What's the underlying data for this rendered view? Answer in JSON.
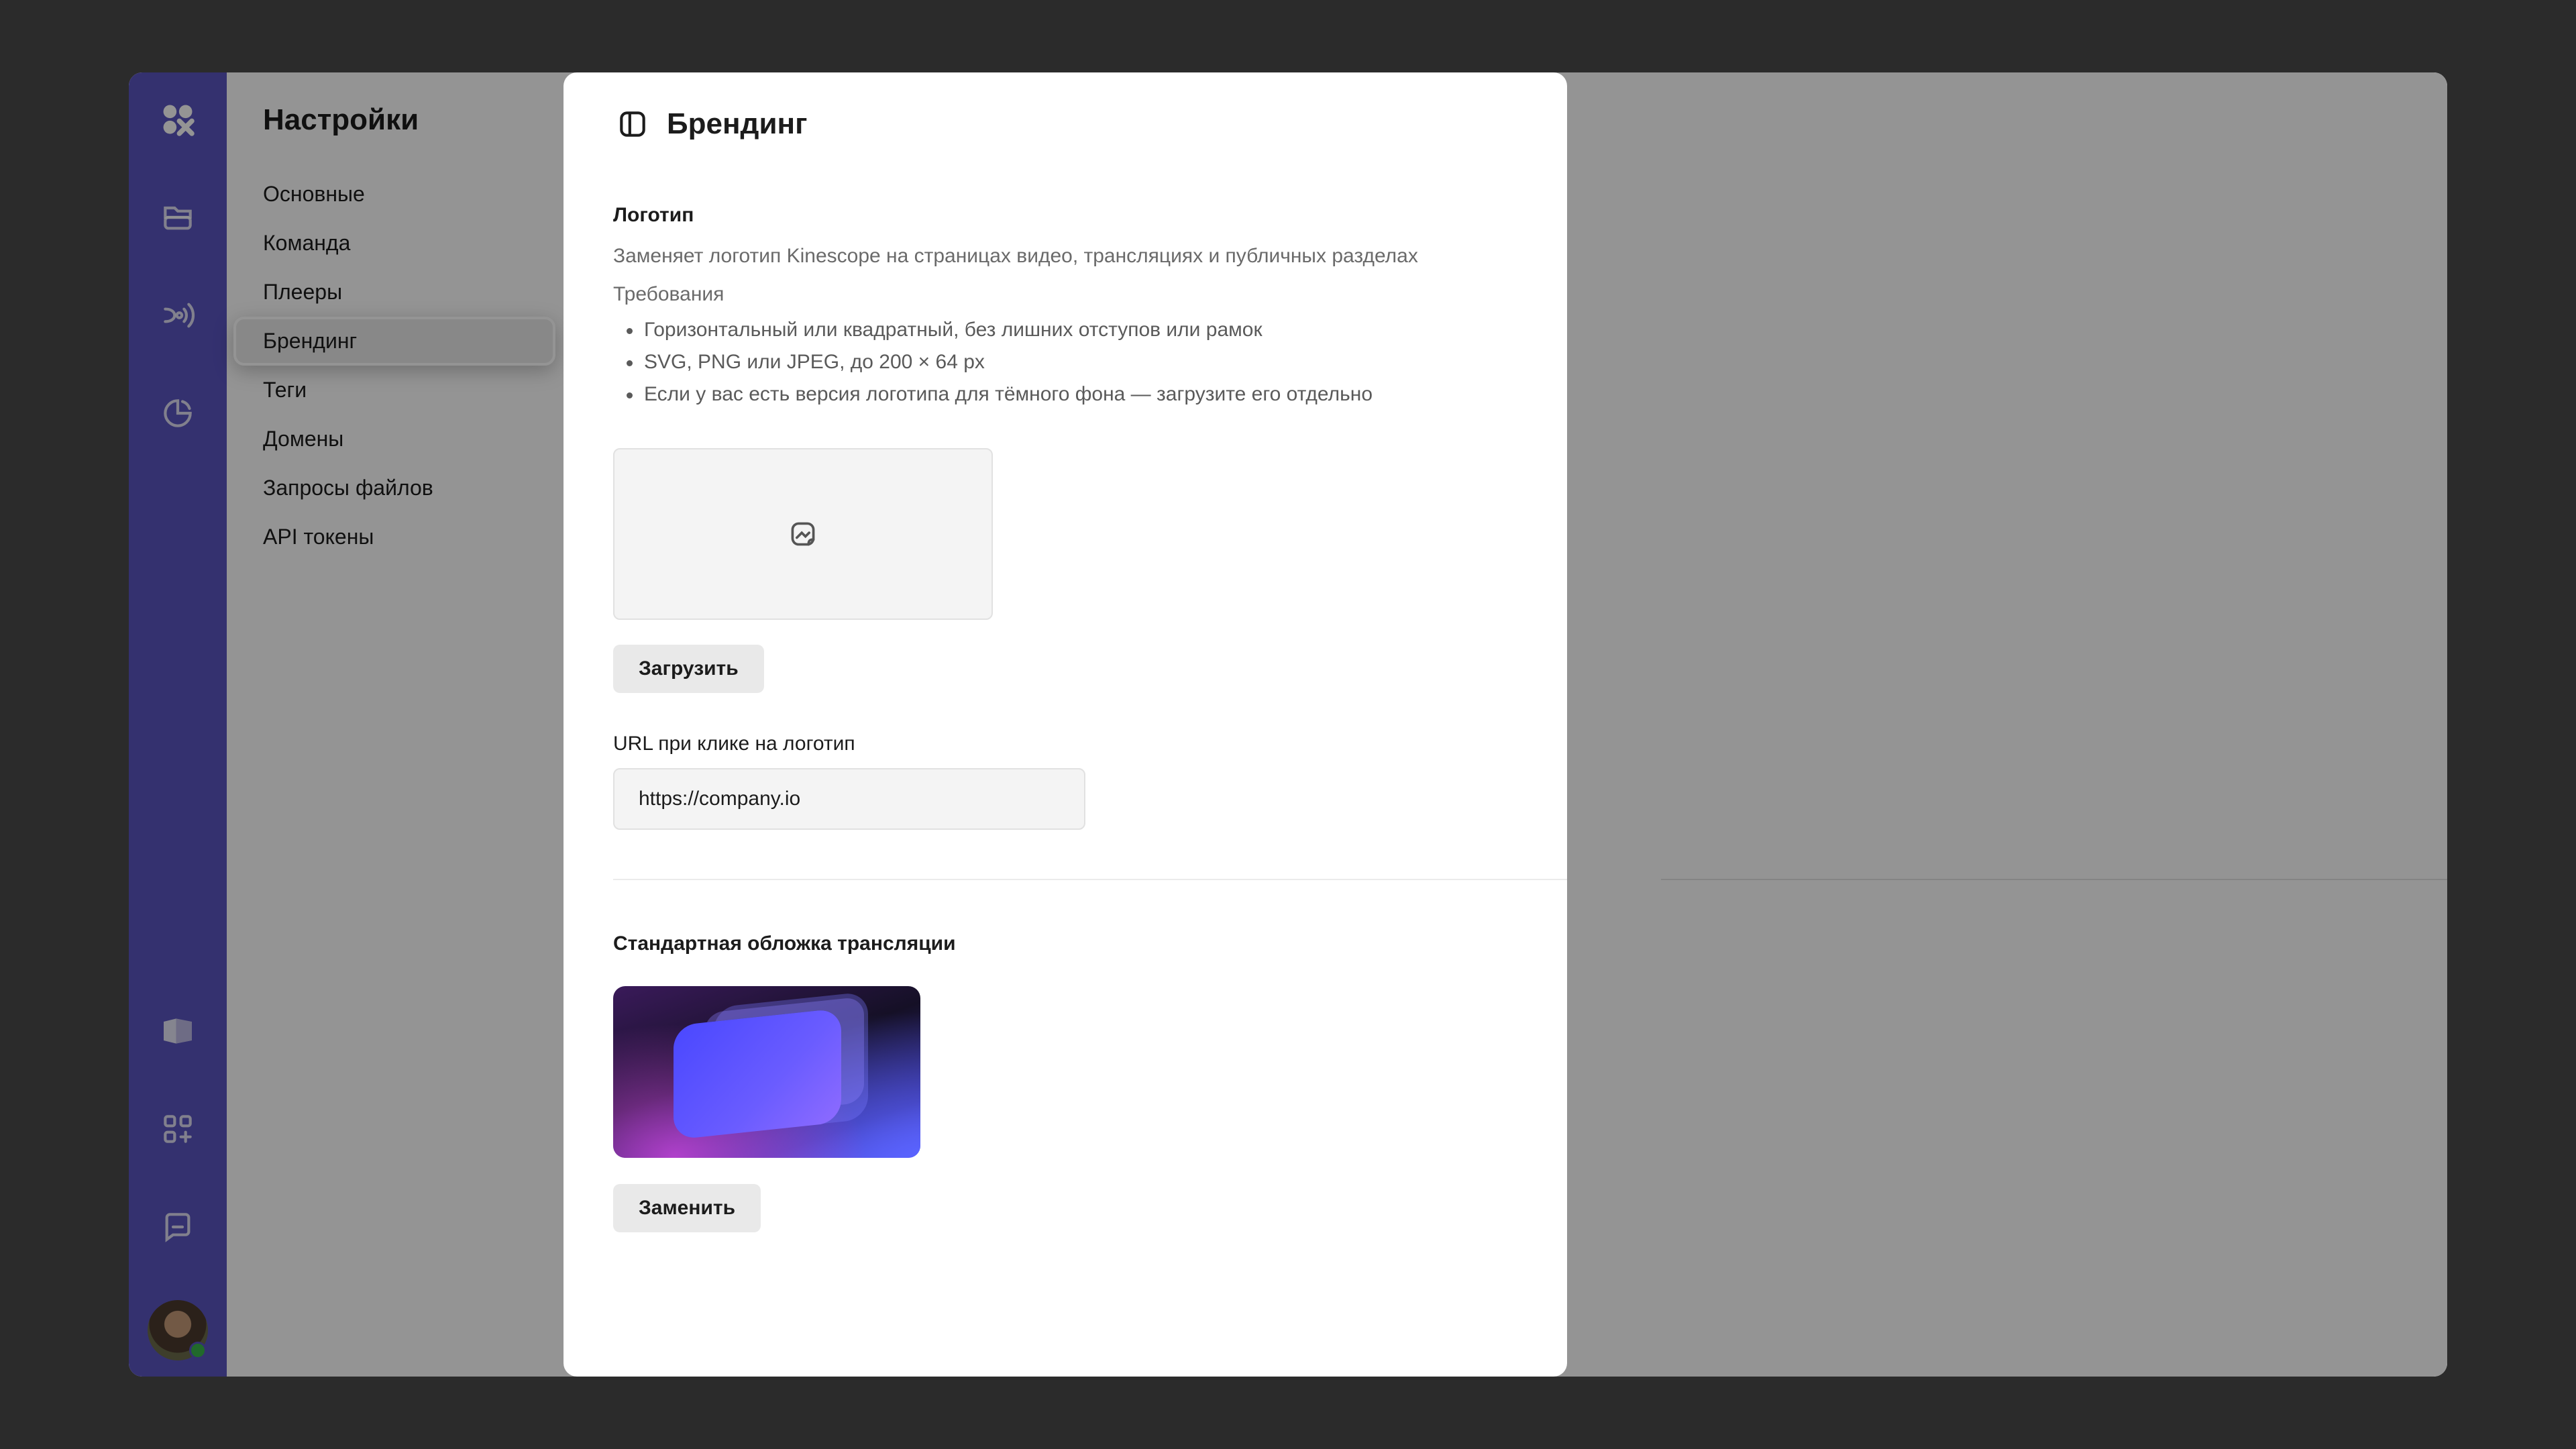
{
  "settings": {
    "title": "Настройки",
    "menu": [
      {
        "label": "Основные"
      },
      {
        "label": "Команда"
      },
      {
        "label": "Плееры"
      },
      {
        "label": "Брендинг"
      },
      {
        "label": "Теги"
      },
      {
        "label": "Домены"
      },
      {
        "label": "Запросы файлов"
      },
      {
        "label": "API токены"
      }
    ],
    "active_item": "Брендинг"
  },
  "rail": {
    "icons": [
      "logo-icon",
      "folder-icon",
      "broadcast-icon",
      "analytics-icon",
      "docs-icon",
      "apps-add-icon",
      "chat-icon",
      "avatar"
    ]
  },
  "panel": {
    "title": "Брендинг",
    "logo": {
      "title": "Логотип",
      "description": "Заменяет логотип Kinescope на страницах видео, трансляциях и публичных разделах",
      "requirements_title": "Требования",
      "requirements": [
        "Горизонтальный или квадратный, без лишних отступов или рамок",
        "SVG, PNG или JPEG, до 200 × 64 px",
        "Если у вас есть версия логотипа для тёмного фона — загрузите его отдельно"
      ],
      "upload_button": "Загрузить"
    },
    "url": {
      "label": "URL при клике на логотип",
      "value": "https://company.io"
    },
    "cover": {
      "title": "Стандартная обложка трансляции",
      "replace_button": "Заменить"
    }
  },
  "colors": {
    "rail": "#5a55c0",
    "backdrop": "#2b2b2b"
  }
}
